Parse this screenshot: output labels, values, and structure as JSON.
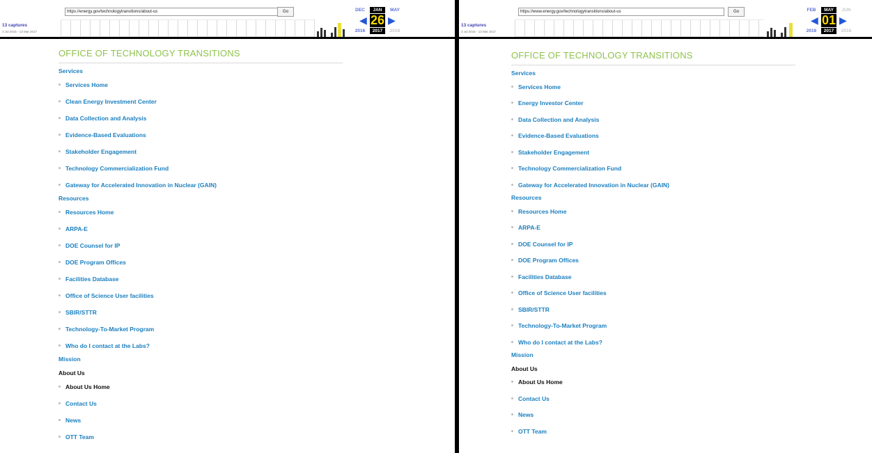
{
  "left": {
    "wayback": {
      "url": "https://energy.gov/technologytransitions/about-us",
      "go_label": "Go",
      "captures": "13 captures",
      "date_range": "3 Jul 2015 - 13 Mar 2017",
      "prev_month": "DEC",
      "current_month": "JAN",
      "next_month": "MAY",
      "day": "26",
      "prev_year": "2016",
      "current_year": "2017",
      "next_year": "2018"
    },
    "title": "OFFICE OF TECHNOLOGY TRANSITIONS",
    "services_heading": "Services",
    "services": [
      "Services Home",
      "Clean Energy Investment Center",
      "Data Collection and Analysis",
      "Evidence-Based Evaluations",
      "Stakeholder Engagement",
      "Technology Commercialization Fund",
      "Gateway for Accelerated Innovation in Nuclear (GAIN)"
    ],
    "resources_heading": "Resources",
    "resources": [
      "Resources Home",
      "ARPA-E",
      "DOE Counsel for IP",
      "DOE Program Offices",
      "Facilities Database",
      "Office of Science User facilities",
      "SBIR/STTR",
      "Technology-To-Market Program",
      "Who do I contact at the Labs?"
    ],
    "mission_heading": "Mission",
    "about_heading": "About Us",
    "about": [
      "About Us Home",
      "Contact Us",
      "News",
      "OTT Team"
    ]
  },
  "right": {
    "wayback": {
      "url": "https://www.energy.gov/technologytransitions/about-us",
      "go_label": "Go",
      "captures": "13 captures",
      "date_range": "3 Jul 2015 - 13 Mar 2017",
      "prev_month": "FEB",
      "current_month": "MAY",
      "next_month": "JUN",
      "day": "01",
      "prev_year": "2016",
      "current_year": "2017",
      "next_year": "2018"
    },
    "title": "OFFICE OF TECHNOLOGY TRANSITIONS",
    "services_heading": "Services",
    "services": [
      "Services Home",
      "Energy Investor Center",
      "Data Collection and Analysis",
      "Evidence-Based Evaluations",
      "Stakeholder Engagement",
      "Technology Commercialization Fund",
      "Gateway for Accelerated Innovation in Nuclear (GAIN)"
    ],
    "resources_heading": "Resources",
    "resources": [
      "Resources Home",
      "ARPA-E",
      "DOE Counsel for IP",
      "DOE Program Offices",
      "Facilities Database",
      "Office of Science User facilities",
      "SBIR/STTR",
      "Technology-To-Market Program",
      "Who do I contact at the Labs?"
    ],
    "mission_heading": "Mission",
    "about_heading": "About Us",
    "about": [
      "About Us Home",
      "Contact Us",
      "News",
      "OTT Team"
    ]
  }
}
